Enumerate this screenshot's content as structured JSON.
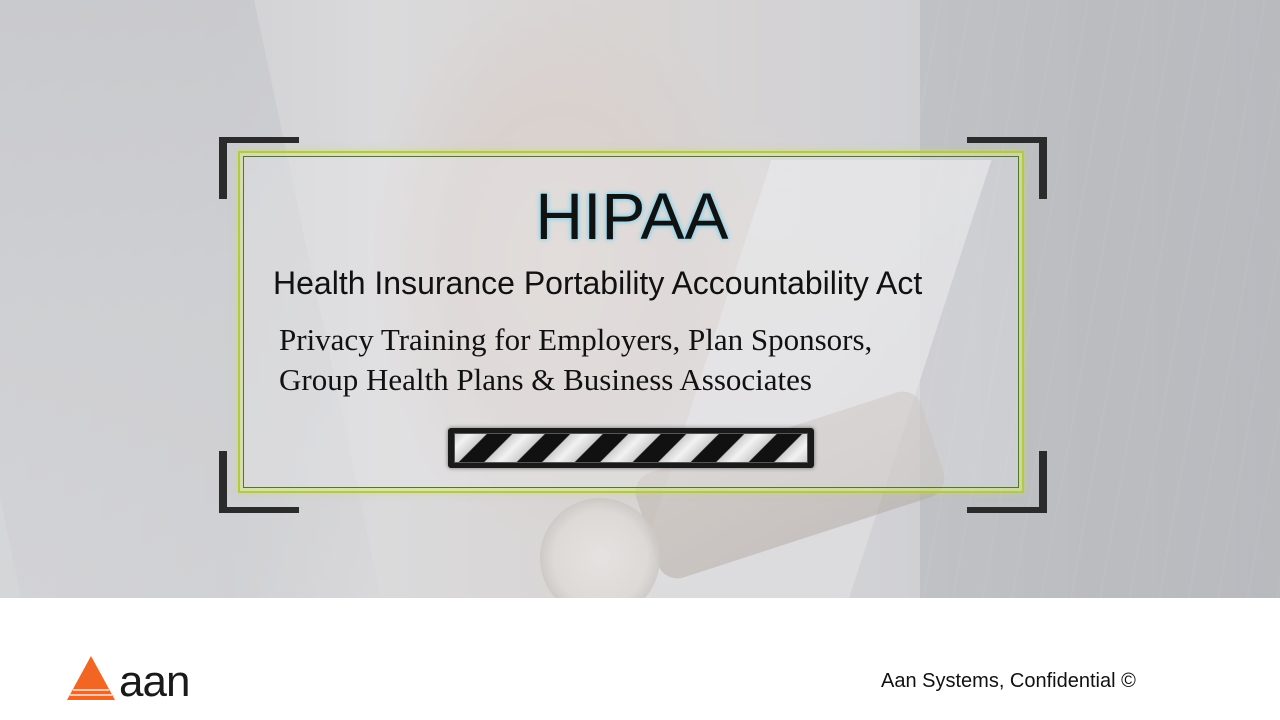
{
  "slide": {
    "title": "HIPAA",
    "subtitle": "Health Insurance Portability Accountability Act",
    "description_lines": [
      "Privacy Training for Employers, Plan Sponsors,",
      "Group Health Plans & Business Associates"
    ]
  },
  "footer": {
    "logo_text": "aan",
    "confidential_note": "Aan Systems, Confidential ©"
  },
  "colors": {
    "frame_accent": "#b5cc3a",
    "bracket": "#2b2b2b",
    "logo_orange": "#f26522",
    "title_glow": "#7ccde6"
  },
  "icons": {
    "logo_mark": "orange-triangle-icon"
  }
}
